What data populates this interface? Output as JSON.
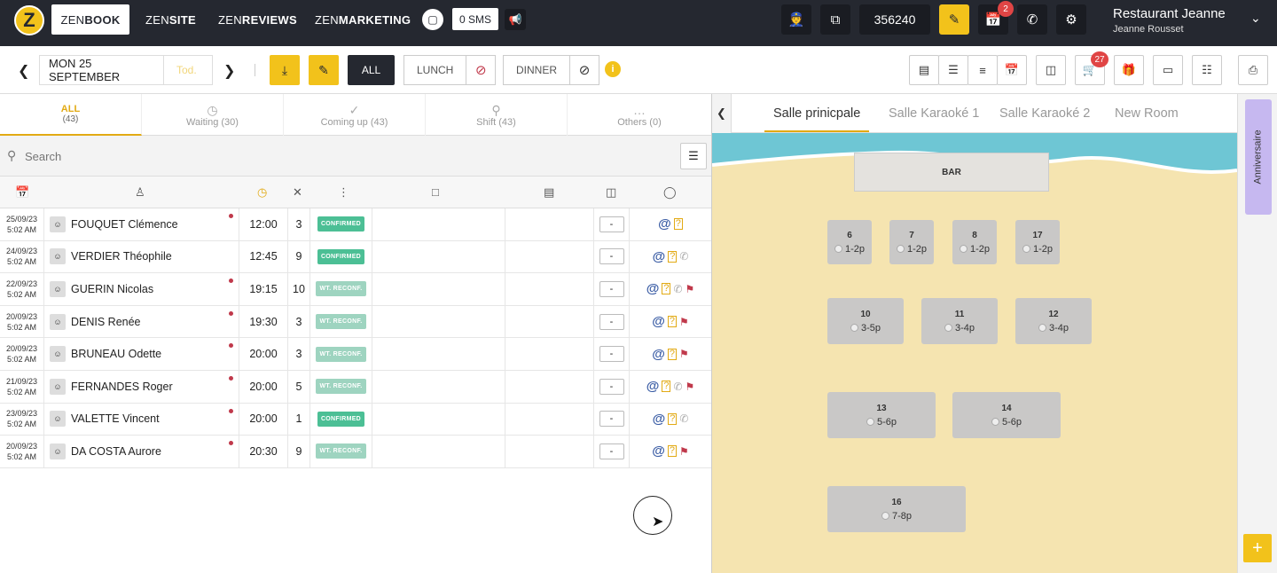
{
  "topbar": {
    "logo": "Z",
    "tabs": [
      {
        "pre": "ZEN",
        "post": "BOOK"
      },
      {
        "pre": "ZEN",
        "post": "SITE"
      },
      {
        "pre": "ZEN",
        "post": "REVIEWS"
      },
      {
        "pre": "ZEN",
        "post": "MARKETING"
      }
    ],
    "sms_label": "0 SMS",
    "code": "356240",
    "notif_badge": "2",
    "restaurant": "Restaurant Jeanne",
    "user": "Jeanne Rousset"
  },
  "toolbar": {
    "date": "MON 25 SEPTEMBER",
    "date_input_placeholder": "Tod.",
    "all_label": "ALL",
    "lunch_label": "LUNCH",
    "dinner_label": "DINNER",
    "info": "i",
    "basket_badge": "27"
  },
  "filters": [
    {
      "label": "ALL",
      "count": "(43)"
    },
    {
      "label": "Waiting (30)"
    },
    {
      "label": "Coming up (43)"
    },
    {
      "label": "Shift (43)"
    },
    {
      "label": "Others (0)"
    }
  ],
  "search": {
    "placeholder": "Search"
  },
  "reservations": [
    {
      "date": "25/09/23",
      "time_created": "5:02 AM",
      "name": "FOUQUET Clémence",
      "dot": true,
      "time": "12:00",
      "pax": "3",
      "status": "CONFIRMED",
      "status_type": "conf",
      "table": "-",
      "phone": false,
      "flag": false
    },
    {
      "date": "24/09/23",
      "time_created": "5:02 AM",
      "name": "VERDIER Théophile",
      "dot": false,
      "time": "12:45",
      "pax": "9",
      "status": "CONFIRMED",
      "status_type": "conf",
      "table": "-",
      "phone": true,
      "flag": false
    },
    {
      "date": "22/09/23",
      "time_created": "5:02 AM",
      "name": "GUERIN Nicolas",
      "dot": true,
      "time": "19:15",
      "pax": "10",
      "status": "WT. RECONF.",
      "status_type": "wt",
      "table": "-",
      "phone": true,
      "flag": true
    },
    {
      "date": "20/09/23",
      "time_created": "5:02 AM",
      "name": "DENIS Renée",
      "dot": true,
      "time": "19:30",
      "pax": "3",
      "status": "WT. RECONF.",
      "status_type": "wt",
      "table": "-",
      "phone": false,
      "flag": true
    },
    {
      "date": "20/09/23",
      "time_created": "5:02 AM",
      "name": "BRUNEAU Odette",
      "dot": true,
      "time": "20:00",
      "pax": "3",
      "status": "WT. RECONF.",
      "status_type": "wt",
      "table": "-",
      "phone": false,
      "flag": true
    },
    {
      "date": "21/09/23",
      "time_created": "5:02 AM",
      "name": "FERNANDES Roger",
      "dot": true,
      "time": "20:00",
      "pax": "5",
      "status": "WT. RECONF.",
      "status_type": "wt",
      "table": "-",
      "phone": true,
      "flag": true
    },
    {
      "date": "23/09/23",
      "time_created": "5:02 AM",
      "name": "VALETTE Vincent",
      "dot": true,
      "time": "20:00",
      "pax": "1",
      "status": "CONFIRMED",
      "status_type": "conf",
      "table": "-",
      "phone": true,
      "flag": false
    },
    {
      "date": "20/09/23",
      "time_created": "5:02 AM",
      "name": "DA COSTA Aurore",
      "dot": true,
      "time": "20:30",
      "pax": "9",
      "status": "WT. RECONF.",
      "status_type": "wt",
      "table": "-",
      "phone": false,
      "flag": true
    }
  ],
  "rooms": {
    "tabs": [
      "Salle prinicpale",
      "Salle Karaoké 1",
      "Salle Karaoké 2",
      "New Room"
    ],
    "bar_label": "BAR",
    "tables": [
      {
        "num": "6",
        "cap": "1-2p"
      },
      {
        "num": "7",
        "cap": "1-2p"
      },
      {
        "num": "8",
        "cap": "1-2p"
      },
      {
        "num": "17",
        "cap": "1-2p"
      },
      {
        "num": "10",
        "cap": "3-5p"
      },
      {
        "num": "11",
        "cap": "3-4p"
      },
      {
        "num": "12",
        "cap": "3-4p"
      },
      {
        "num": "13",
        "cap": "5-6p"
      },
      {
        "num": "14",
        "cap": "5-6p"
      },
      {
        "num": "16",
        "cap": "7-8p"
      }
    ]
  },
  "sidebar": {
    "anniversary": "Anniversaire",
    "add": "+"
  },
  "colors": {
    "accent": "#f2c21b",
    "dark": "#252830",
    "confirmed": "#4cbf95",
    "waiting": "#9ed4c0",
    "sea": "#6ec6d4",
    "sand": "#f5e4b0"
  }
}
